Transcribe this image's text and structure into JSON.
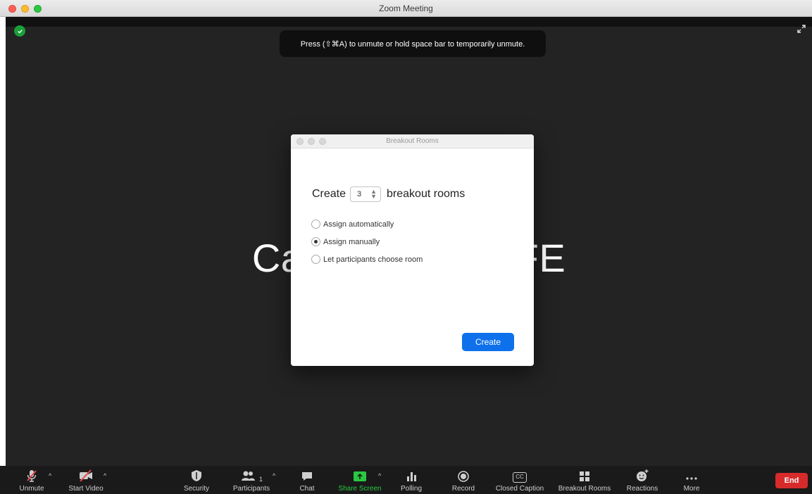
{
  "window": {
    "title": "Zoom Meeting"
  },
  "notification": {
    "text": "Press (⇧⌘A) to unmute or hold space bar to temporarily unmute."
  },
  "participant": {
    "name": "CanSFE CanSFE"
  },
  "dialog": {
    "title": "Breakout Rooms",
    "create_prefix": "Create",
    "room_count": "3",
    "create_suffix": "breakout rooms",
    "options": [
      {
        "label": "Assign automatically",
        "selected": false
      },
      {
        "label": "Assign manually",
        "selected": true
      },
      {
        "label": "Let participants choose room",
        "selected": false
      }
    ],
    "create_button": "Create"
  },
  "toolbar": {
    "unmute": "Unmute",
    "start_video": "Start Video",
    "security": "Security",
    "participants": "Participants",
    "participants_count": "1",
    "chat": "Chat",
    "share_screen": "Share Screen",
    "polling": "Polling",
    "record": "Record",
    "closed_caption": "Closed Caption",
    "closed_caption_icon_text": "CC",
    "breakout_rooms": "Breakout Rooms",
    "reactions": "Reactions",
    "more": "More",
    "end": "End"
  },
  "colors": {
    "accent_blue": "#0e71eb",
    "end_red": "#d72b2b",
    "share_green": "#29c840",
    "meeting_bg": "#232323"
  }
}
